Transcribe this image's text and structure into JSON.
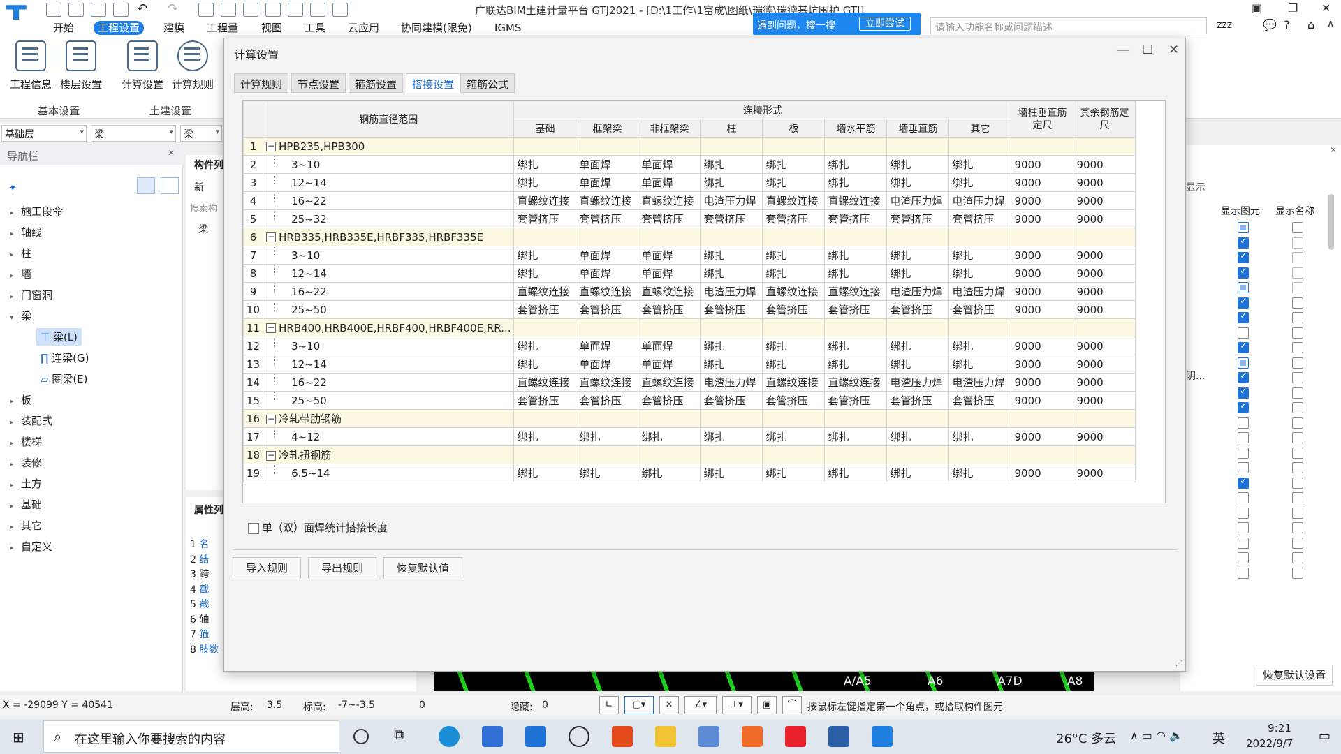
{
  "app": {
    "title": "广联达BIM土建计量平台 GTJ2021 - [D:\\1工作\\1富成\\图纸\\瑞德\\瑞德基坑围护.GTJ]",
    "logo": "T",
    "promo_text": "遇到问题，搜一搜",
    "promo_button": "立即尝试",
    "search_placeholder": "请输入功能名称或问题描述",
    "user": "zzz"
  },
  "menu": [
    "开始",
    "工程设置",
    "建模",
    "工程量",
    "视图",
    "工具",
    "云应用",
    "协同建模(限免)",
    "IGMS"
  ],
  "menu_active": "工程设置",
  "ribbon": {
    "buttons": [
      "工程信息",
      "楼层设置",
      "计算设置",
      "计算规则"
    ],
    "groups": [
      "基本设置",
      "土建设置"
    ]
  },
  "floorbar": {
    "floor": "基础层",
    "type": "梁",
    "sub": "梁"
  },
  "nav": {
    "header": "导航栏",
    "items": [
      "施工段命",
      "轴线",
      "柱",
      "墙",
      "门窗洞",
      "梁",
      "板",
      "装配式",
      "楼梯",
      "装修",
      "土方",
      "基础",
      "其它",
      "自定义"
    ],
    "beam_sub": [
      "梁(L)",
      "连梁(G)",
      "圈梁(E)"
    ]
  },
  "mid": {
    "col_header": "构件列",
    "new": "新",
    "search": "搜索构",
    "tree": "梁",
    "prop_header": "属性列",
    "prop_rows": [
      "名",
      "结",
      "跨",
      "截",
      "截",
      "轴",
      "箍",
      "肢数"
    ],
    "prop_val": "2"
  },
  "right": {
    "col1": "显示图元",
    "col2": "显示名称",
    "hint": "显示",
    "truncated": "阴...",
    "restore": "恢复默认设置",
    "checks": [
      "sq",
      "on",
      "on",
      "on",
      "sq",
      "on",
      "on",
      "off",
      "on",
      "sq",
      "on",
      "on",
      "on",
      "off",
      "off",
      "off",
      "off",
      "on",
      "off",
      "off",
      "off",
      "off",
      "off",
      "off"
    ]
  },
  "cad_labels": [
    "A/A5",
    "A6",
    "A7D",
    "A8"
  ],
  "status": {
    "coords": "X = -29099 Y = 40541",
    "floor_h": "层高:",
    "floor_h_v": "3.5",
    "elev": "标高:",
    "elev_v": "-7~-3.5",
    "zero": "0",
    "hidden": "隐藏:",
    "hidden_v": "0",
    "tip": "按鼠标左键指定第一个角点，或拾取构件图元"
  },
  "taskbar": {
    "search": "在这里输入你要搜索的内容",
    "weather": "26°C 多云",
    "ime": "英",
    "time": "9:21",
    "date": "2022/9/7"
  },
  "dialog": {
    "title": "计算设置",
    "tabs": [
      "计算规则",
      "节点设置",
      "箍筋设置",
      "搭接设置",
      "箍筋公式"
    ],
    "active_tab": "搭接设置",
    "header_range": "钢筋直径范围",
    "header_conn": "连接形式",
    "header_cols": [
      "基础",
      "框架梁",
      "非框架梁",
      "柱",
      "板",
      "墙水平筋",
      "墙垂直筋",
      "其它"
    ],
    "header_wall": "墙柱垂直筋定尺",
    "header_other": "其余钢筋定尺",
    "rows": [
      {
        "n": "1",
        "g": true,
        "name": "HPB235,HPB300"
      },
      {
        "n": "2",
        "name": "3~10",
        "v": [
          "绑扎",
          "单面焊",
          "单面焊",
          "绑扎",
          "绑扎",
          "绑扎",
          "绑扎",
          "绑扎",
          "9000",
          "9000"
        ]
      },
      {
        "n": "3",
        "name": "12~14",
        "v": [
          "绑扎",
          "单面焊",
          "单面焊",
          "绑扎",
          "绑扎",
          "绑扎",
          "绑扎",
          "绑扎",
          "9000",
          "9000"
        ]
      },
      {
        "n": "4",
        "name": "16~22",
        "v": [
          "直螺纹连接",
          "直螺纹连接",
          "直螺纹连接",
          "电渣压力焊",
          "直螺纹连接",
          "直螺纹连接",
          "电渣压力焊",
          "电渣压力焊",
          "9000",
          "9000"
        ]
      },
      {
        "n": "5",
        "name": "25~32",
        "v": [
          "套管挤压",
          "套管挤压",
          "套管挤压",
          "套管挤压",
          "套管挤压",
          "套管挤压",
          "套管挤压",
          "套管挤压",
          "9000",
          "9000"
        ]
      },
      {
        "n": "6",
        "g": true,
        "name": "HRB335,HRB335E,HRBF335,HRBF335E"
      },
      {
        "n": "7",
        "name": "3~10",
        "v": [
          "绑扎",
          "单面焊",
          "单面焊",
          "绑扎",
          "绑扎",
          "绑扎",
          "绑扎",
          "绑扎",
          "9000",
          "9000"
        ]
      },
      {
        "n": "8",
        "name": "12~14",
        "v": [
          "绑扎",
          "单面焊",
          "单面焊",
          "绑扎",
          "绑扎",
          "绑扎",
          "绑扎",
          "绑扎",
          "9000",
          "9000"
        ]
      },
      {
        "n": "9",
        "name": "16~22",
        "v": [
          "直螺纹连接",
          "直螺纹连接",
          "直螺纹连接",
          "电渣压力焊",
          "直螺纹连接",
          "直螺纹连接",
          "电渣压力焊",
          "电渣压力焊",
          "9000",
          "9000"
        ]
      },
      {
        "n": "10",
        "name": "25~50",
        "v": [
          "套管挤压",
          "套管挤压",
          "套管挤压",
          "套管挤压",
          "套管挤压",
          "套管挤压",
          "套管挤压",
          "套管挤压",
          "9000",
          "9000"
        ]
      },
      {
        "n": "11",
        "g": true,
        "name": "HRB400,HRB400E,HRBF400,HRBF400E,RR..."
      },
      {
        "n": "12",
        "name": "3~10",
        "v": [
          "绑扎",
          "单面焊",
          "单面焊",
          "绑扎",
          "绑扎",
          "绑扎",
          "绑扎",
          "绑扎",
          "9000",
          "9000"
        ]
      },
      {
        "n": "13",
        "name": "12~14",
        "v": [
          "绑扎",
          "单面焊",
          "单面焊",
          "绑扎",
          "绑扎",
          "绑扎",
          "绑扎",
          "绑扎",
          "9000",
          "9000"
        ]
      },
      {
        "n": "14",
        "name": "16~22",
        "v": [
          "直螺纹连接",
          "直螺纹连接",
          "直螺纹连接",
          "电渣压力焊",
          "直螺纹连接",
          "直螺纹连接",
          "电渣压力焊",
          "电渣压力焊",
          "9000",
          "9000"
        ]
      },
      {
        "n": "15",
        "name": "25~50",
        "v": [
          "套管挤压",
          "套管挤压",
          "套管挤压",
          "套管挤压",
          "套管挤压",
          "套管挤压",
          "套管挤压",
          "套管挤压",
          "9000",
          "9000"
        ]
      },
      {
        "n": "16",
        "g": true,
        "name": "冷轧带肋钢筋"
      },
      {
        "n": "17",
        "name": "4~12",
        "v": [
          "绑扎",
          "绑扎",
          "绑扎",
          "绑扎",
          "绑扎",
          "绑扎",
          "绑扎",
          "绑扎",
          "9000",
          "9000"
        ]
      },
      {
        "n": "18",
        "g": true,
        "name": "冷轧扭钢筋"
      },
      {
        "n": "19",
        "name": "6.5~14",
        "v": [
          "绑扎",
          "绑扎",
          "绑扎",
          "绑扎",
          "绑扎",
          "绑扎",
          "绑扎",
          "绑扎",
          "9000",
          "9000"
        ]
      }
    ],
    "checkbox_label": "单（双）面焊统计搭接长度",
    "buttons": [
      "导入规则",
      "导出规则",
      "恢复默认值"
    ]
  }
}
